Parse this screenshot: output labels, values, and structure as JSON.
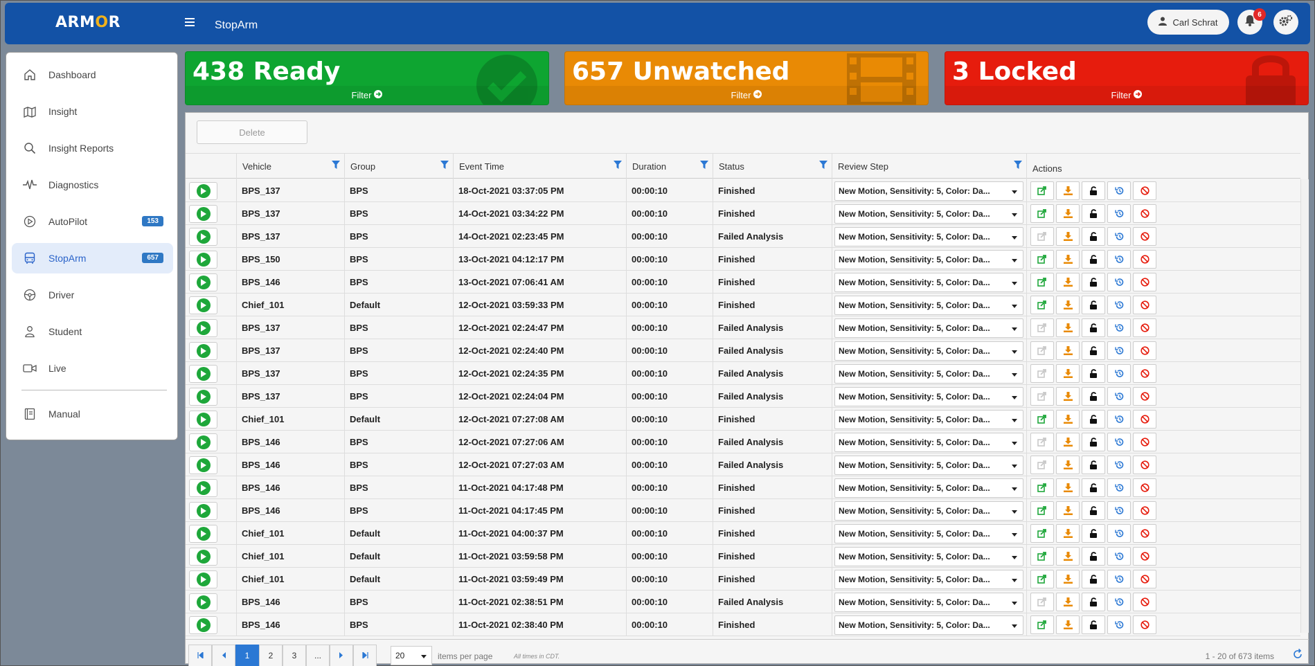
{
  "header": {
    "logo_text_a": "ARM",
    "logo_text_o": "O",
    "logo_text_b": "R",
    "page_title": "StopArm",
    "user_name": "Carl Schrat",
    "notification_count": "6"
  },
  "sidebar": {
    "items": [
      {
        "label": "Dashboard",
        "icon": "home-icon"
      },
      {
        "label": "Insight",
        "icon": "map-icon"
      },
      {
        "label": "Insight Reports",
        "icon": "search-icon"
      },
      {
        "label": "Diagnostics",
        "icon": "pulse-icon"
      },
      {
        "label": "AutoPilot",
        "icon": "play-circle-icon",
        "badge": "153"
      },
      {
        "label": "StopArm",
        "icon": "bus-icon",
        "badge": "657",
        "active": true
      },
      {
        "label": "Driver",
        "icon": "steering-wheel-icon"
      },
      {
        "label": "Student",
        "icon": "student-icon"
      },
      {
        "label": "Live",
        "icon": "video-icon"
      },
      {
        "label": "Manual",
        "icon": "book-icon"
      }
    ]
  },
  "cards": {
    "ready": {
      "label": "438 Ready",
      "filter": "Filter",
      "color": "#0ea531"
    },
    "unwatched": {
      "label": "657 Unwatched",
      "filter": "Filter",
      "color": "#e98a05"
    },
    "locked": {
      "label": "3 Locked",
      "filter": "Filter",
      "color": "#e61c0d"
    }
  },
  "toolbar": {
    "delete_label": "Delete"
  },
  "grid": {
    "columns": {
      "vehicle": "Vehicle",
      "group": "Group",
      "event_time": "Event Time",
      "duration": "Duration",
      "status": "Status",
      "review_step": "Review Step",
      "actions": "Actions"
    },
    "rows": [
      {
        "vehicle": "BPS_137",
        "group": "BPS",
        "time": "18-Oct-2021 03:37:05 PM",
        "duration": "00:00:10",
        "status": "Finished",
        "review": "New Motion, Sensitivity: 5, Color: Da...",
        "share_enabled": true
      },
      {
        "vehicle": "BPS_137",
        "group": "BPS",
        "time": "14-Oct-2021 03:34:22 PM",
        "duration": "00:00:10",
        "status": "Finished",
        "review": "New Motion, Sensitivity: 5, Color: Da...",
        "share_enabled": true
      },
      {
        "vehicle": "BPS_137",
        "group": "BPS",
        "time": "14-Oct-2021 02:23:45 PM",
        "duration": "00:00:10",
        "status": "Failed Analysis",
        "review": "New Motion, Sensitivity: 5, Color: Da...",
        "share_enabled": false
      },
      {
        "vehicle": "BPS_150",
        "group": "BPS",
        "time": "13-Oct-2021 04:12:17 PM",
        "duration": "00:00:10",
        "status": "Finished",
        "review": "New Motion, Sensitivity: 5, Color: Da...",
        "share_enabled": true
      },
      {
        "vehicle": "BPS_146",
        "group": "BPS",
        "time": "13-Oct-2021 07:06:41 AM",
        "duration": "00:00:10",
        "status": "Finished",
        "review": "New Motion, Sensitivity: 5, Color: Da...",
        "share_enabled": true
      },
      {
        "vehicle": "Chief_101",
        "group": "Default",
        "time": "12-Oct-2021 03:59:33 PM",
        "duration": "00:00:10",
        "status": "Finished",
        "review": "New Motion, Sensitivity: 5, Color: Da...",
        "share_enabled": true
      },
      {
        "vehicle": "BPS_137",
        "group": "BPS",
        "time": "12-Oct-2021 02:24:47 PM",
        "duration": "00:00:10",
        "status": "Failed Analysis",
        "review": "New Motion, Sensitivity: 5, Color: Da...",
        "share_enabled": false
      },
      {
        "vehicle": "BPS_137",
        "group": "BPS",
        "time": "12-Oct-2021 02:24:40 PM",
        "duration": "00:00:10",
        "status": "Failed Analysis",
        "review": "New Motion, Sensitivity: 5, Color: Da...",
        "share_enabled": false
      },
      {
        "vehicle": "BPS_137",
        "group": "BPS",
        "time": "12-Oct-2021 02:24:35 PM",
        "duration": "00:00:10",
        "status": "Failed Analysis",
        "review": "New Motion, Sensitivity: 5, Color: Da...",
        "share_enabled": false
      },
      {
        "vehicle": "BPS_137",
        "group": "BPS",
        "time": "12-Oct-2021 02:24:04 PM",
        "duration": "00:00:10",
        "status": "Failed Analysis",
        "review": "New Motion, Sensitivity: 5, Color: Da...",
        "share_enabled": false
      },
      {
        "vehicle": "Chief_101",
        "group": "Default",
        "time": "12-Oct-2021 07:27:08 AM",
        "duration": "00:00:10",
        "status": "Finished",
        "review": "New Motion, Sensitivity: 5, Color: Da...",
        "share_enabled": true
      },
      {
        "vehicle": "BPS_146",
        "group": "BPS",
        "time": "12-Oct-2021 07:27:06 AM",
        "duration": "00:00:10",
        "status": "Failed Analysis",
        "review": "New Motion, Sensitivity: 5, Color: Da...",
        "share_enabled": false
      },
      {
        "vehicle": "BPS_146",
        "group": "BPS",
        "time": "12-Oct-2021 07:27:03 AM",
        "duration": "00:00:10",
        "status": "Failed Analysis",
        "review": "New Motion, Sensitivity: 5, Color: Da...",
        "share_enabled": false
      },
      {
        "vehicle": "BPS_146",
        "group": "BPS",
        "time": "11-Oct-2021 04:17:48 PM",
        "duration": "00:00:10",
        "status": "Finished",
        "review": "New Motion, Sensitivity: 5, Color: Da...",
        "share_enabled": true
      },
      {
        "vehicle": "BPS_146",
        "group": "BPS",
        "time": "11-Oct-2021 04:17:45 PM",
        "duration": "00:00:10",
        "status": "Finished",
        "review": "New Motion, Sensitivity: 5, Color: Da...",
        "share_enabled": true
      },
      {
        "vehicle": "Chief_101",
        "group": "Default",
        "time": "11-Oct-2021 04:00:37 PM",
        "duration": "00:00:10",
        "status": "Finished",
        "review": "New Motion, Sensitivity: 5, Color: Da...",
        "share_enabled": true
      },
      {
        "vehicle": "Chief_101",
        "group": "Default",
        "time": "11-Oct-2021 03:59:58 PM",
        "duration": "00:00:10",
        "status": "Finished",
        "review": "New Motion, Sensitivity: 5, Color: Da...",
        "share_enabled": true
      },
      {
        "vehicle": "Chief_101",
        "group": "Default",
        "time": "11-Oct-2021 03:59:49 PM",
        "duration": "00:00:10",
        "status": "Finished",
        "review": "New Motion, Sensitivity: 5, Color: Da...",
        "share_enabled": true
      },
      {
        "vehicle": "BPS_146",
        "group": "BPS",
        "time": "11-Oct-2021 02:38:51 PM",
        "duration": "00:00:10",
        "status": "Failed Analysis",
        "review": "New Motion, Sensitivity: 5, Color: Da...",
        "share_enabled": false
      },
      {
        "vehicle": "BPS_146",
        "group": "BPS",
        "time": "11-Oct-2021 02:38:40 PM",
        "duration": "00:00:10",
        "status": "Finished",
        "review": "New Motion, Sensitivity: 5, Color: Da...",
        "share_enabled": true
      }
    ]
  },
  "pager": {
    "pages": [
      "1",
      "2",
      "3",
      "..."
    ],
    "current_page": "1",
    "per_page": "20",
    "per_page_label": "items per page",
    "tz_note": "All times in CDT.",
    "range": "1 - 20 of 673 items"
  },
  "colors": {
    "header_blue": "#1352a6",
    "play_green": "#1ea73a",
    "share_green": "#1ea73a",
    "download_orange": "#e98a05",
    "history_blue": "#2b78d4",
    "cancel_red": "#e61c0d"
  }
}
